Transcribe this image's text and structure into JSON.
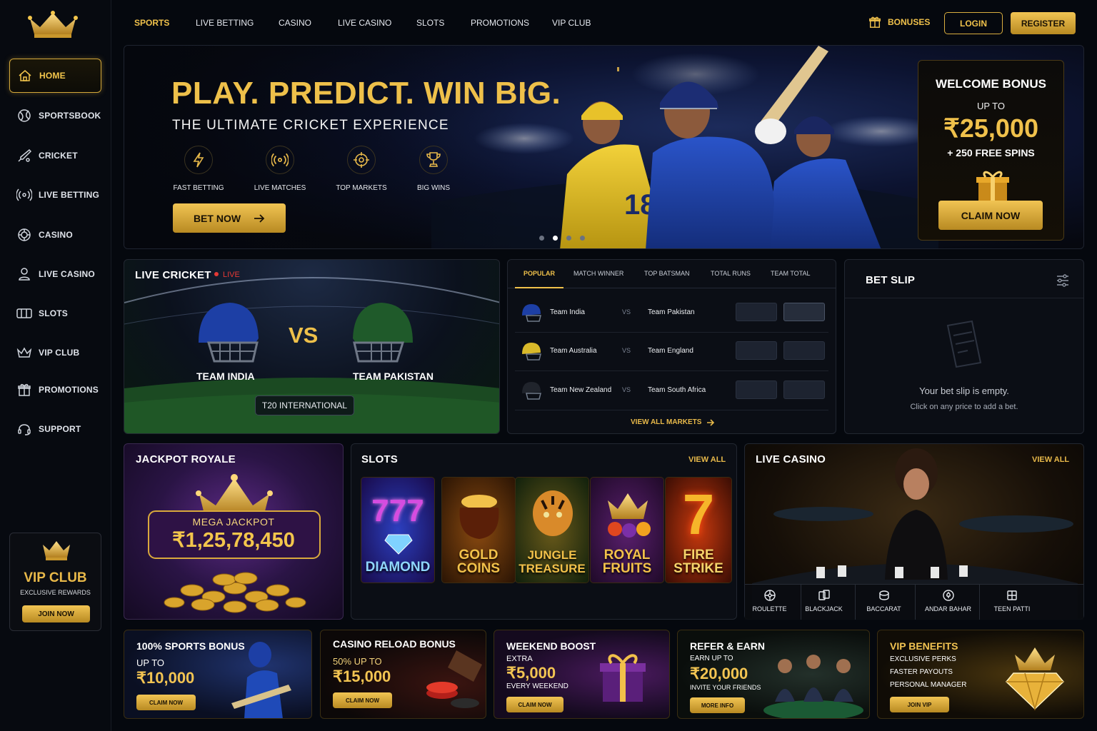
{
  "sidebar": {
    "items": [
      {
        "label": "HOME",
        "icon": "home-icon"
      },
      {
        "label": "SPORTSBOOK",
        "icon": "ball-icon"
      },
      {
        "label": "CRICKET",
        "icon": "cricket-bat-icon"
      },
      {
        "label": "LIVE BETTING",
        "icon": "broadcast-icon"
      },
      {
        "label": "CASINO",
        "icon": "chip-icon"
      },
      {
        "label": "LIVE CASINO",
        "icon": "dealer-icon"
      },
      {
        "label": "SLOTS",
        "icon": "slot-machine-icon"
      },
      {
        "label": "VIP CLUB",
        "icon": "crown-icon"
      },
      {
        "label": "PROMOTIONS",
        "icon": "gift-icon"
      },
      {
        "label": "SUPPORT",
        "icon": "headset-icon"
      }
    ],
    "vip": {
      "title": "VIP CLUB",
      "subtitle": "EXCLUSIVE REWARDS",
      "button": "JOIN NOW"
    }
  },
  "topnav": {
    "links": [
      "SPORTS",
      "LIVE BETTING",
      "CASINO",
      "LIVE CASINO",
      "SLOTS",
      "PROMOTIONS",
      "VIP CLUB"
    ],
    "bonuses": "BONUSES",
    "login": "LOGIN",
    "register": "REGISTER"
  },
  "hero": {
    "headline": "PLAY. PREDICT. WIN BIG.",
    "subhead": "THE ULTIMATE CRICKET EXPERIENCE",
    "features": [
      "FAST BETTING",
      "LIVE MATCHES",
      "TOP MARKETS",
      "BIG WINS"
    ],
    "cta": "BET NOW",
    "jersey_number": "18",
    "slides_total": 4,
    "slide_active": 2,
    "welcome": {
      "title": "WELCOME BONUS",
      "up_to": "UP TO",
      "amount": "₹25,000",
      "spins": "+ 250 FREE SPINS",
      "button": "CLAIM NOW"
    }
  },
  "live_cricket": {
    "title": "LIVE CRICKET",
    "live": "LIVE",
    "vs": "VS",
    "team1": "TEAM INDIA",
    "team2": "TEAM PAKISTAN",
    "format": "T20 INTERNATIONAL"
  },
  "markets": {
    "tabs": [
      "POPULAR",
      "MATCH WINNER",
      "TOP BATSMAN",
      "TOTAL RUNS",
      "TEAM TOTAL"
    ],
    "rows": [
      {
        "home": "Team India",
        "vs": "VS",
        "away": "Team Pakistan"
      },
      {
        "home": "Team Australia",
        "vs": "VS",
        "away": "Team England"
      },
      {
        "home": "Team New Zealand",
        "vs": "VS",
        "away": "Team South Africa"
      }
    ],
    "view_all": "VIEW ALL MARKETS"
  },
  "betslip": {
    "title": "BET SLIP",
    "empty": "Your bet slip is empty.",
    "hint": "Click on any price to add a bet."
  },
  "jackpot": {
    "title": "JACKPOT ROYALE",
    "label": "MEGA JACKPOT",
    "amount": "₹1,25,78,450"
  },
  "slots": {
    "title": "SLOTS",
    "view_all": "VIEW ALL",
    "games": [
      {
        "top": "777",
        "bottom": "DIAMOND"
      },
      {
        "top": "GOLD",
        "bottom": "COINS"
      },
      {
        "top": "JUNGLE",
        "bottom": "TREASURE"
      },
      {
        "top": "ROYAL",
        "bottom": "FRUITS"
      },
      {
        "top": "FIRE",
        "bottom": "STRIKE"
      }
    ]
  },
  "live_casino": {
    "title": "LIVE CASINO",
    "view_all": "VIEW ALL",
    "games": [
      "ROULETTE",
      "BLACKJACK",
      "BACCARAT",
      "ANDAR BAHAR",
      "TEEN PATTI"
    ]
  },
  "promos": [
    {
      "title": "100% SPORTS BONUS",
      "line1": "UP TO",
      "amount": "₹10,000",
      "line2": "",
      "button": "CLAIM NOW"
    },
    {
      "title": "CASINO RELOAD BONUS",
      "line1": "50% UP TO",
      "amount": "₹15,000",
      "line2": "",
      "button": "CLAIM NOW"
    },
    {
      "title": "WEEKEND BOOST",
      "line1": "EXTRA",
      "amount": "₹5,000",
      "line2": "EVERY WEEKEND",
      "button": "CLAIM NOW"
    },
    {
      "title": "REFER & EARN",
      "line1": "EARN UP TO",
      "amount": "₹20,000",
      "line2": "INVITE YOUR FRIENDS",
      "button": "MORE INFO"
    },
    {
      "title": "VIP BENEFITS",
      "line1": "EXCLUSIVE PERKS",
      "amount": "",
      "line2": "",
      "button": "JOIN VIP",
      "extra": [
        "FASTER PAYOUTS",
        "PERSONAL MANAGER"
      ]
    }
  ],
  "colors": {
    "gold": "#f0c14b",
    "live_red": "#e53935",
    "bg": "#05080e"
  }
}
